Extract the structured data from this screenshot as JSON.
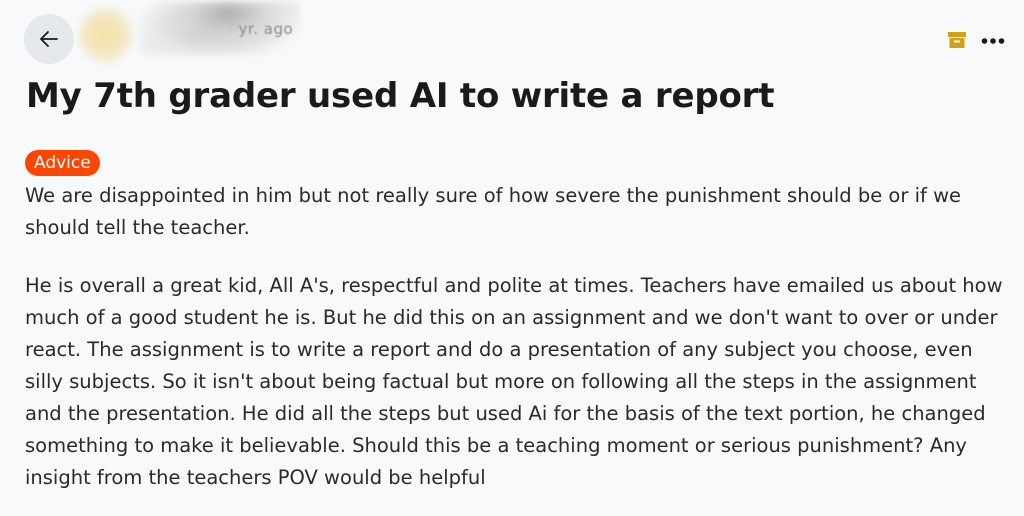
{
  "header": {
    "time_text": "yr. ago",
    "back_icon": "arrow-left-icon",
    "save_icon": "archive-icon",
    "more_icon": "more-horizontal-icon",
    "save_icon_color": "#d4a017"
  },
  "post": {
    "title": "My 7th grader used AI to write a report",
    "flair": "Advice",
    "flair_color": "#ff4500",
    "body": [
      "We are disappointed in him but not really sure of how severe the punishment should be or if we should tell the teacher.",
      "He is overall a great kid, All A's, respectful and polite at times. Teachers have emailed us about how much of a good student he is. But he did this on an assignment and we don't want to over or under react. The assignment is to write a report and do a presentation of any subject you choose, even silly subjects. So it isn't about being factual but more on following all the steps in the assignment and the presentation. He did all the steps but used Ai for the basis of the text portion, he changed something to make it believable. Should this be a teaching moment or serious punishment? Any insight from the teachers POV would be helpful"
    ]
  }
}
